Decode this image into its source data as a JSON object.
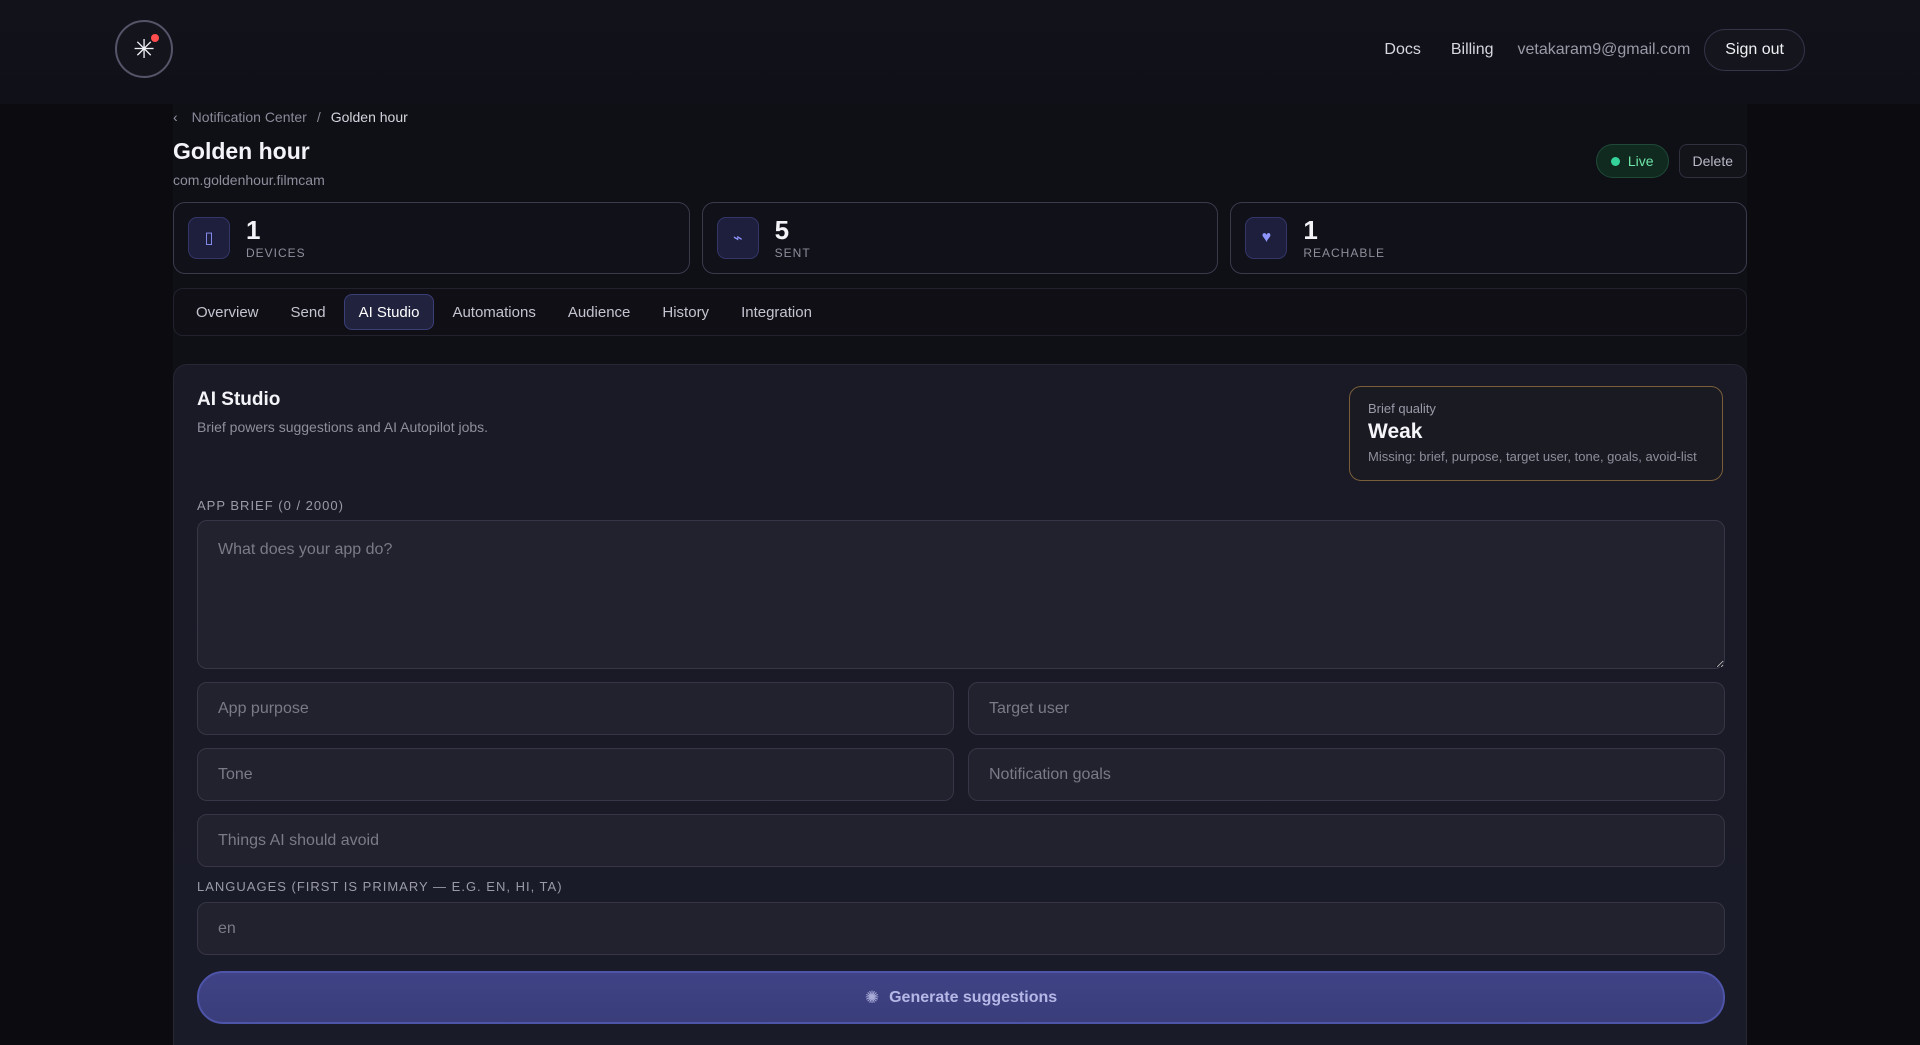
{
  "header": {
    "nav": [
      "Docs",
      "Billing"
    ],
    "email": "vetakaram9@gmail.com",
    "sign_out": "Sign out"
  },
  "breadcrumb": {
    "parent": "Notification Center",
    "separator": "/",
    "current": "Golden hour"
  },
  "app": {
    "title": "Golden hour",
    "package": "com.goldenhour.filmcam",
    "status": "Live",
    "delete_label": "Delete"
  },
  "stats": [
    {
      "icon": "phone-icon",
      "value": "1",
      "label": "DEVICES"
    },
    {
      "icon": "send-icon",
      "value": "5",
      "label": "SENT"
    },
    {
      "icon": "heart-icon",
      "value": "1",
      "label": "REACHABLE"
    }
  ],
  "tabs": [
    {
      "label": "Overview",
      "active": false
    },
    {
      "label": "Send",
      "active": false
    },
    {
      "label": "AI Studio",
      "active": true
    },
    {
      "label": "Automations",
      "active": false
    },
    {
      "label": "Audience",
      "active": false
    },
    {
      "label": "History",
      "active": false
    },
    {
      "label": "Integration",
      "active": false
    }
  ],
  "studio": {
    "title": "AI Studio",
    "subtitle": "Brief powers suggestions and AI Autopilot jobs.",
    "quality": {
      "label": "Brief quality",
      "value": "Weak",
      "missing": "Missing: brief, purpose, target user, tone, goals, avoid-list"
    },
    "brief_label": "APP BRIEF (0 / 2000)",
    "brief_placeholder": "What does your app do?",
    "purpose_placeholder": "App purpose",
    "target_placeholder": "Target user",
    "tone_placeholder": "Tone",
    "goals_placeholder": "Notification goals",
    "avoid_placeholder": "Things AI should avoid",
    "languages_label": "LANGUAGES (FIRST IS PRIMARY — E.G. EN, HI, TA)",
    "languages_placeholder": "en",
    "generate_label": "Generate suggestions"
  },
  "colors": {
    "accent": "#3f4386",
    "live": "#34d399",
    "quality_border": "#7a5e3a"
  }
}
